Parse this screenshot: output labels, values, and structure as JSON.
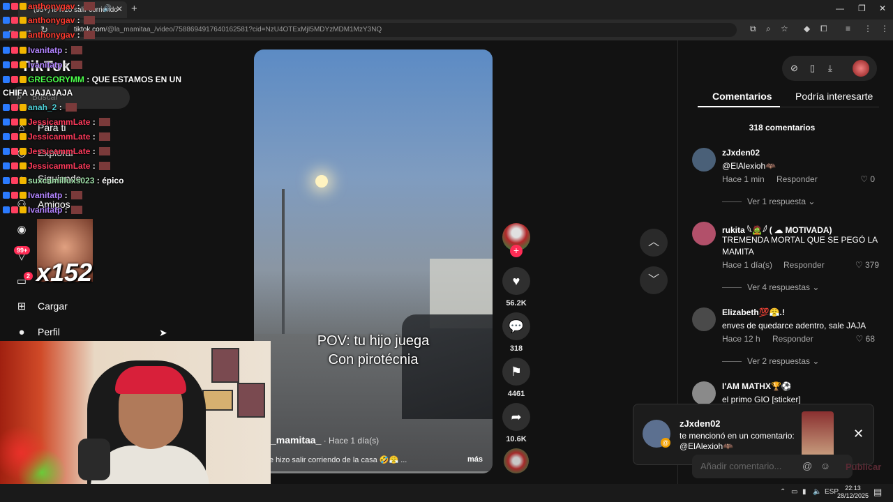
{
  "browser": {
    "tab_title": "(95+) le hizo salir corriendo",
    "url_domain": "tiktok.com",
    "url_path": "/@la_mamitaa_/video/7588694917640162581?cid=NzU4OTExMjI5MDYzMDM1MzY3NQ"
  },
  "sidebar": {
    "logo": "TikTok",
    "search_placeholder": "Buscar",
    "items": [
      {
        "label": "Para ti"
      },
      {
        "label": "Explorar"
      },
      {
        "label": "Siguiendo"
      },
      {
        "label": "Amigos"
      },
      {
        "label": "Cargar"
      },
      {
        "label": "Perfil"
      }
    ],
    "badges": {
      "inbox": "99+",
      "messages": "2"
    }
  },
  "video": {
    "overlay_text_line1": "POV: tu hijo juega",
    "overlay_text_line2": "Con pirotécnia",
    "username": "_mamitaa_",
    "posted": " · Hace 1 día(s)",
    "description": "e hizo salir corriendo de la casa 🤣😤 ...",
    "more": "más",
    "progress": 0.05
  },
  "actions": {
    "likes": "56.2K",
    "comments": "318",
    "saves": "4461",
    "shares": "10.6K"
  },
  "panel": {
    "tab_comments": "Comentarios",
    "tab_suggested": "Podría interesarte",
    "count": "318 comentarios",
    "reply_label": "Responder",
    "comments": [
      {
        "name": "zJxden02",
        "text": "@ElAlexioh🦇",
        "time": "Hace 1 min",
        "likes": "0",
        "view": "Ver 1 respuesta"
      },
      {
        "name": "rukita 𓆩🧟𓆪 ( ☁ MOTIVADA)",
        "text": "TREMENDA MORTAL QUE SE PEGÓ LA MAMITA",
        "time": "Hace 1 día(s)",
        "likes": "379",
        "view": "Ver 4 respuestas"
      },
      {
        "name": "Elizabeth💯😤.!",
        "text": "enves de quedarce adentro, sale JAJA",
        "time": "Hace 12 h",
        "likes": "68",
        "view": "Ver 2 respuestas"
      },
      {
        "name": "I'AM MATHX🏆⚽",
        "text": "el primo GIO [sticker]"
      }
    ],
    "input_placeholder": "Añadir comentario...",
    "publish": "Publicar"
  },
  "toast": {
    "name": "zJxden02",
    "message": "te mencionó en un comentario: @ElAlexioh🦇"
  },
  "chat": [
    {
      "user": "anthonygav",
      "text": "",
      "color": "#ff3b30"
    },
    {
      "user": "anthonygav",
      "text": "",
      "color": "#ff3b30"
    },
    {
      "user": "anthonygav",
      "text": "",
      "color": "#ff3b30"
    },
    {
      "user": "Ivanitatp",
      "text": "",
      "color": "#b284ff"
    },
    {
      "user": "Ivanitatp",
      "text": "",
      "color": "#b284ff"
    },
    {
      "user": "GREGORYMM",
      "text": " QUE ESTAMOS EN UN",
      "color": "#4cff4c"
    },
    {
      "user": "CHIFA JAJAJAJA",
      "text": "",
      "color": "#ffffff"
    },
    {
      "user": "anah_2",
      "text": "",
      "color": "#4fd1d9"
    },
    {
      "user": "JessicammLate",
      "text": "",
      "color": "#ff3b5c"
    },
    {
      "user": "JessicammLate",
      "text": "",
      "color": "#ff3b5c"
    },
    {
      "user": "JessicammLate",
      "text": "",
      "color": "#ff3b5c"
    },
    {
      "user": "JessicammLate",
      "text": "",
      "color": "#ff3b5c"
    },
    {
      "user": "suxcamilluxs023",
      "text": " épico",
      "color": "#9fe0a8"
    },
    {
      "user": "Ivanitatp",
      "text": "",
      "color": "#b284ff"
    },
    {
      "user": "Ivanitatp",
      "text": "",
      "color": "#b284ff"
    }
  ],
  "chat_emote_count": "x152",
  "taskbar": {
    "lang": "ESP",
    "time": "22:13",
    "date": "28/12/2025"
  }
}
